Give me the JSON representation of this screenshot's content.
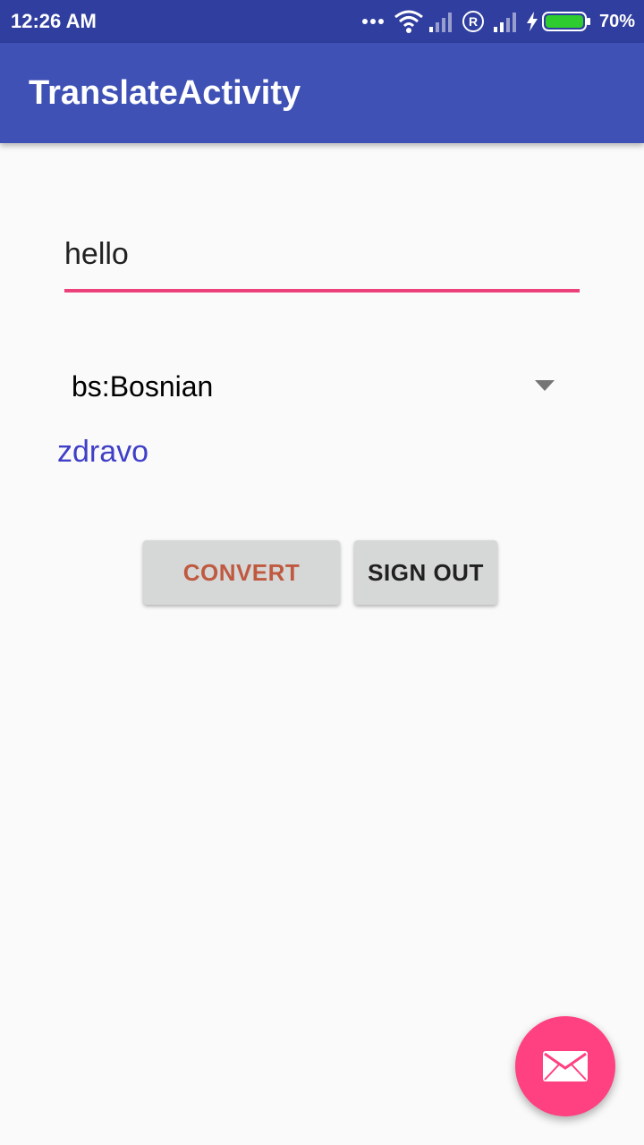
{
  "status_bar": {
    "time": "12:26 AM",
    "battery_percent": "70%",
    "battery_level": 0.7,
    "icons": [
      "more-dots-icon",
      "wifi-icon",
      "signal-icon",
      "roaming-r-icon",
      "signal-icon",
      "charging-bolt-icon",
      "battery-icon"
    ]
  },
  "app_bar": {
    "title": "TranslateActivity"
  },
  "input": {
    "value": "hello"
  },
  "spinner": {
    "selected": "bs:Bosnian",
    "icon": "dropdown-arrow-icon"
  },
  "result": {
    "text": "zdravo"
  },
  "buttons": {
    "convert": "CONVERT",
    "sign_out": "SIGN OUT"
  },
  "fab": {
    "icon": "mail-icon"
  },
  "colors": {
    "status_bar": "#303f9f",
    "app_bar": "#3f51b5",
    "accent": "#ff4081",
    "input_underline": "#ec407a",
    "result_text": "#3f3fc8",
    "convert_text": "#bf5a40"
  }
}
